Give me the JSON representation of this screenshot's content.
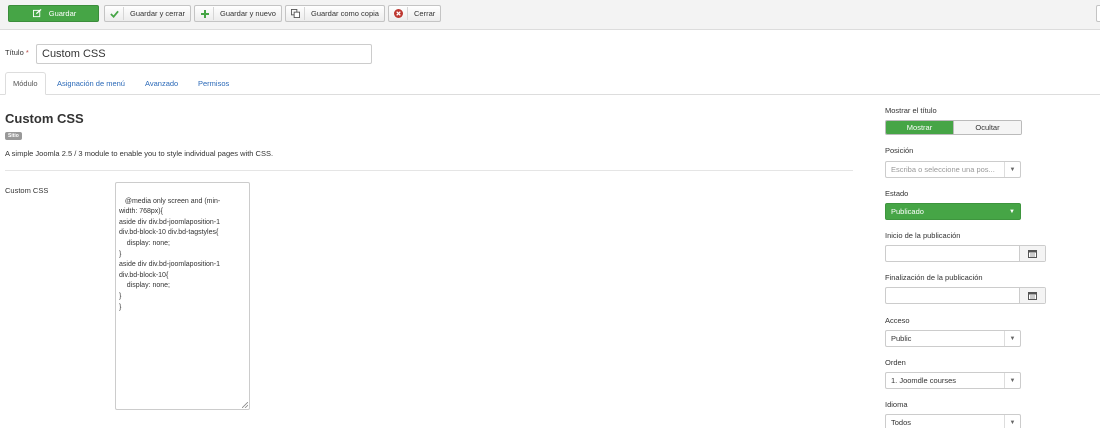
{
  "toolbar": {
    "save": "Guardar",
    "save_close": "Guardar y cerrar",
    "save_new": "Guardar y nuevo",
    "save_copy": "Guardar como copia",
    "close": "Cerrar"
  },
  "title_field": {
    "label": "Título",
    "required": "*",
    "value": "Custom CSS"
  },
  "tabs": [
    "Módulo",
    "Asignación de menú",
    "Avanzado",
    "Permisos"
  ],
  "module": {
    "title": "Custom CSS",
    "badge": "Sitio",
    "description": "A simple Joomla 2.5 / 3 module to enable you to style individual pages with CSS.",
    "css_label": "Custom CSS",
    "css_value": " @media only screen and (min-\nwidth: 768px){\naside div div.bd-joomlaposition-1\ndiv.bd-block-10 div.bd-tagstyles{\n    display: none;\n}\naside div div.bd-joomlaposition-1\ndiv.bd-block-10{\n    display: none;\n}\n}"
  },
  "sidebar": {
    "show_title_label": "Mostrar el título",
    "show_option": "Mostrar",
    "hide_option": "Ocultar",
    "position_label": "Posición",
    "position_placeholder": "Escriba o seleccione una pos...",
    "status_label": "Estado",
    "status_value": "Publicado",
    "publish_start_label": "Inicio de la publicación",
    "publish_start_value": "",
    "publish_end_label": "Finalización de la publicación",
    "publish_end_value": "",
    "access_label": "Acceso",
    "access_value": "Public",
    "order_label": "Orden",
    "order_value": "1. Joomdle courses",
    "language_label": "Idioma",
    "language_value": "Todos"
  },
  "colors": {
    "primary_green": "#46a546",
    "link_blue": "#2a69b8",
    "danger_red": "#bd362f"
  }
}
